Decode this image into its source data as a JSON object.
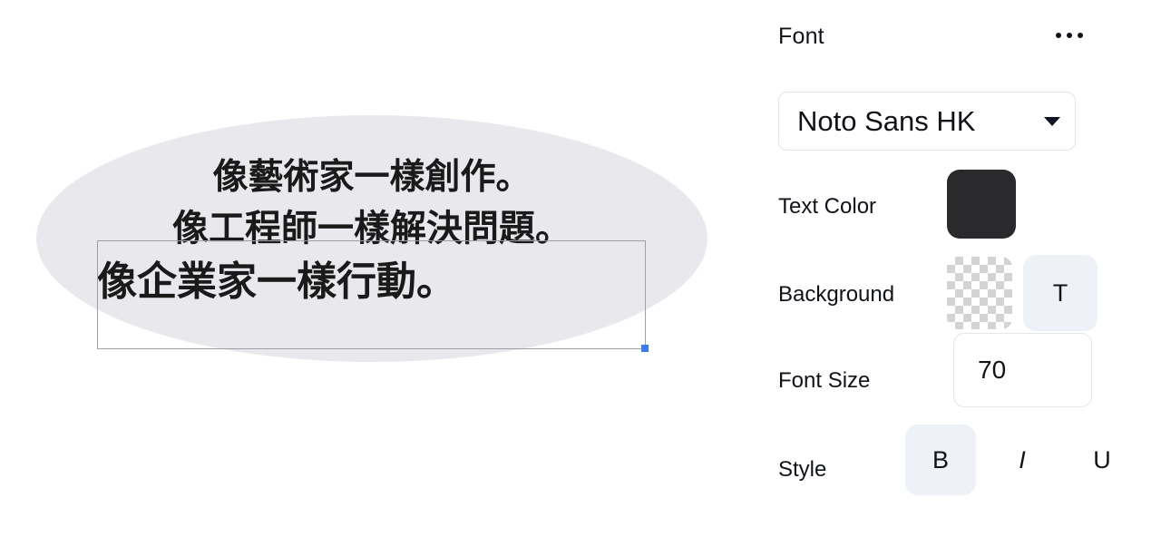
{
  "canvas": {
    "shape": "ellipse",
    "shape_fill": "#e9e8ec",
    "text_lines": [
      "像藝術家一樣創作。",
      "像工程師一樣解決問題。",
      "像企業家一樣行動。"
    ],
    "selection": {
      "handle_color": "#3b7bf0",
      "border_color": "#9aa0a6"
    }
  },
  "panel": {
    "title": "Font",
    "overflow_menu_icon": "ellipsis-icon",
    "font": {
      "label": "Font",
      "selected": "Noto Sans HK",
      "caret_icon": "chevron-down-icon"
    },
    "text_color": {
      "label": "Text Color",
      "value": "#2a2a2d"
    },
    "background": {
      "label": "Background",
      "value": "transparent",
      "transparent_button_label": "T",
      "transparent_button_bg": "#eef2f8"
    },
    "font_size": {
      "label": "Font Size",
      "value": "70",
      "placeholder": "70"
    },
    "style": {
      "label": "Style",
      "options": [
        {
          "key": "bold",
          "label": "B",
          "active": true
        },
        {
          "key": "italic",
          "label": "I",
          "active": false
        },
        {
          "key": "underline",
          "label": "U",
          "active": false
        }
      ]
    }
  }
}
